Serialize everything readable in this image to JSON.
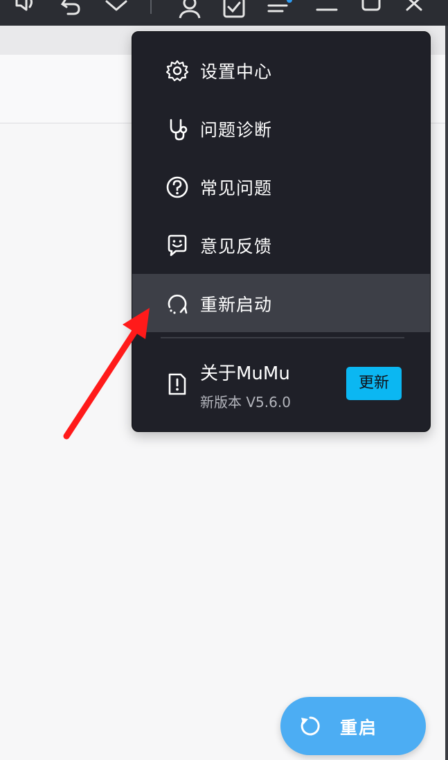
{
  "menu": {
    "items": [
      {
        "label": "设置中心",
        "icon": "gear-icon"
      },
      {
        "label": "问题诊断",
        "icon": "stethoscope-icon"
      },
      {
        "label": "常见问题",
        "icon": "question-circle-icon"
      },
      {
        "label": "意见反馈",
        "icon": "feedback-icon"
      },
      {
        "label": "重新启动",
        "icon": "restart-icon",
        "highlighted": true
      }
    ],
    "about": {
      "title": "关于MuMu",
      "version_text": "新版本 V5.6.0",
      "update_label": "更新",
      "icon": "info-document-icon"
    }
  },
  "restart_button": {
    "label": "重启",
    "icon": "refresh-icon"
  },
  "annotation": {
    "type": "red-arrow",
    "color": "#ff1a1a"
  },
  "colors": {
    "menu_bg": "#1f2028",
    "menu_active": "#3d3f47",
    "accent_update": "#0bb7f2",
    "fab": "#4cadf3",
    "topbar": "#2b2d33"
  }
}
